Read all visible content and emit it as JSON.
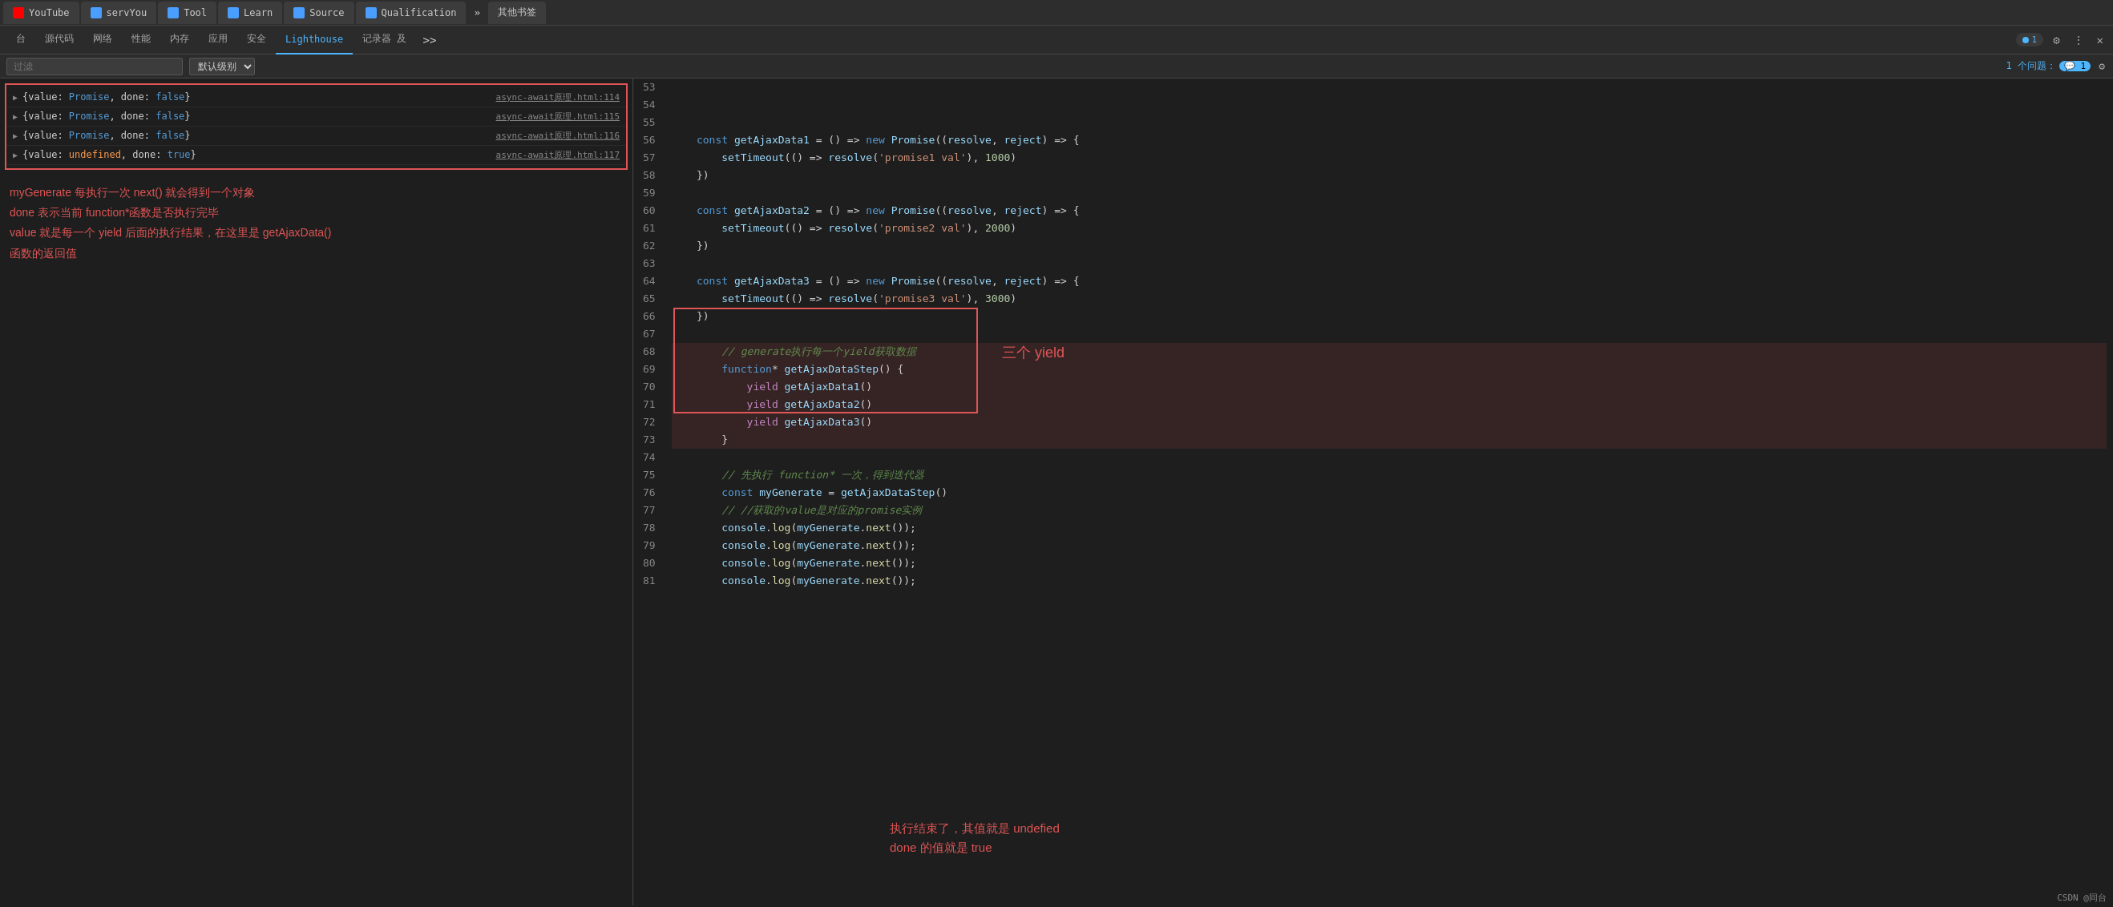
{
  "browser": {
    "tabs": [
      {
        "id": "yt",
        "label": "YouTube",
        "icon": "yt"
      },
      {
        "id": "serv",
        "label": "servYou",
        "icon": "blue"
      },
      {
        "id": "tool",
        "label": "Tool",
        "icon": "blue"
      },
      {
        "id": "learn",
        "label": "Learn",
        "icon": "blue"
      },
      {
        "id": "source",
        "label": "Source",
        "icon": "blue"
      },
      {
        "id": "qual",
        "label": "Qualification",
        "icon": "blue"
      }
    ],
    "tab_more": "»",
    "other_tabs": "其他书签"
  },
  "devtools": {
    "tabs": [
      {
        "id": "console-tab",
        "label": "台",
        "active": false
      },
      {
        "id": "source-tab",
        "label": "源代码",
        "active": false
      },
      {
        "id": "network-tab",
        "label": "网络",
        "active": false
      },
      {
        "id": "perf-tab",
        "label": "性能",
        "active": false
      },
      {
        "id": "memory-tab",
        "label": "内存",
        "active": false
      },
      {
        "id": "app-tab",
        "label": "应用",
        "active": false
      },
      {
        "id": "security-tab",
        "label": "安全",
        "active": false
      },
      {
        "id": "lighthouse-tab",
        "label": "Lighthouse",
        "active": true
      },
      {
        "id": "recorder-tab",
        "label": "记录器 及",
        "active": false
      }
    ],
    "tab_more": ">>",
    "badge": "1",
    "badge_icon": "💬"
  },
  "console_filter": {
    "placeholder": "过滤",
    "level": "默认级别",
    "issues_label": "1 个问题：",
    "issues_count": "💬 1"
  },
  "console_entries": [
    {
      "arrow": "▶",
      "text_parts": [
        {
          "text": "{value: ",
          "cls": ""
        },
        {
          "text": "Promise",
          "cls": "kw-blue"
        },
        {
          "text": ", done: ",
          "cls": ""
        },
        {
          "text": "false",
          "cls": "kw-blue"
        },
        {
          "text": "}",
          "cls": ""
        }
      ],
      "link": "async-await原理.html:114"
    },
    {
      "arrow": "▶",
      "text_parts": [
        {
          "text": "{value: ",
          "cls": ""
        },
        {
          "text": "Promise",
          "cls": "kw-blue"
        },
        {
          "text": ", done: ",
          "cls": ""
        },
        {
          "text": "false",
          "cls": "kw-blue"
        },
        {
          "text": "}",
          "cls": ""
        }
      ],
      "link": "async-await原理.html:115"
    },
    {
      "arrow": "▶",
      "text_parts": [
        {
          "text": "{value: ",
          "cls": ""
        },
        {
          "text": "Promise",
          "cls": "kw-blue"
        },
        {
          "text": ", done: ",
          "cls": ""
        },
        {
          "text": "false",
          "cls": "kw-blue"
        },
        {
          "text": "}",
          "cls": ""
        }
      ],
      "link": "async-await原理.html:116"
    },
    {
      "arrow": "▶",
      "text_parts": [
        {
          "text": "{value: ",
          "cls": ""
        },
        {
          "text": "undefined",
          "cls": "kw-orange"
        },
        {
          "text": ", done: ",
          "cls": ""
        },
        {
          "text": "true",
          "cls": "kw-blue"
        },
        {
          "text": "}",
          "cls": ""
        }
      ],
      "link": "async-await原理.html:117"
    }
  ],
  "annotation_lines": [
    "myGenerate 每执行一次 next() 就会得到一个对象",
    "done 表示当前 function*函数是否执行完毕",
    "value 就是每一个 yield 后面的执行结果，在这里是 getAjaxData()",
    "函数的返回值"
  ],
  "code_lines": [
    {
      "num": "53",
      "content": ""
    },
    {
      "num": "54",
      "content": "    const getAjaxData1 = () => new Promise((resolve, reject) => {"
    },
    {
      "num": "55",
      "content": "        setTimeout(() => resolve('promise1 val'), 1000)"
    },
    {
      "num": "56",
      "content": "    })"
    },
    {
      "num": "57",
      "content": ""
    },
    {
      "num": "58",
      "content": "    const getAjaxData2 = () => new Promise((resolve, reject) => {"
    },
    {
      "num": "59",
      "content": "        setTimeout(() => resolve('promise2 val'), 2000)"
    },
    {
      "num": "60",
      "content": "    })"
    },
    {
      "num": "61",
      "content": ""
    },
    {
      "num": "62",
      "content": "    const getAjaxData3 = () => new Promise((resolve, reject) => {"
    },
    {
      "num": "63",
      "content": "        setTimeout(() => resolve('promise3 val'), 3000)"
    },
    {
      "num": "64",
      "content": "    })"
    },
    {
      "num": "65",
      "content": ""
    },
    {
      "num": "66",
      "content": "        // generate执行每一个yield获取数据",
      "highlighted": true
    },
    {
      "num": "67",
      "content": "        function* getAjaxDataStep() {",
      "highlighted": true
    },
    {
      "num": "68",
      "content": "            yield getAjaxData1()",
      "highlighted": true
    },
    {
      "num": "69",
      "content": "            yield getAjaxData2()",
      "highlighted": true
    },
    {
      "num": "70",
      "content": "            yield getAjaxData3()",
      "highlighted": true
    },
    {
      "num": "71",
      "content": "        }",
      "highlighted": true
    },
    {
      "num": "72",
      "content": ""
    },
    {
      "num": "73",
      "content": "        // 先执行 function* 一次，得到迭代器"
    },
    {
      "num": "74",
      "content": "        const myGenerate = getAjaxDataStep()"
    },
    {
      "num": "75",
      "content": "        // //获取的value是对应的promise实例"
    },
    {
      "num": "76",
      "content": "        console.log(myGenerate.next());"
    },
    {
      "num": "77",
      "content": "        console.log(myGenerate.next());"
    },
    {
      "num": "78",
      "content": "        console.log(myGenerate.next());"
    },
    {
      "num": "79",
      "content": "        console.log(myGenerate.next());"
    },
    {
      "num": "80",
      "content": ""
    },
    {
      "num": "81",
      "content": ""
    }
  ],
  "right_annotation": "三个 yield",
  "bottom_annotation_line1": "执行结束了，其值就是 undefied",
  "bottom_annotation_line2": "done 的值就是 true",
  "watermark": "CSDN @同台"
}
